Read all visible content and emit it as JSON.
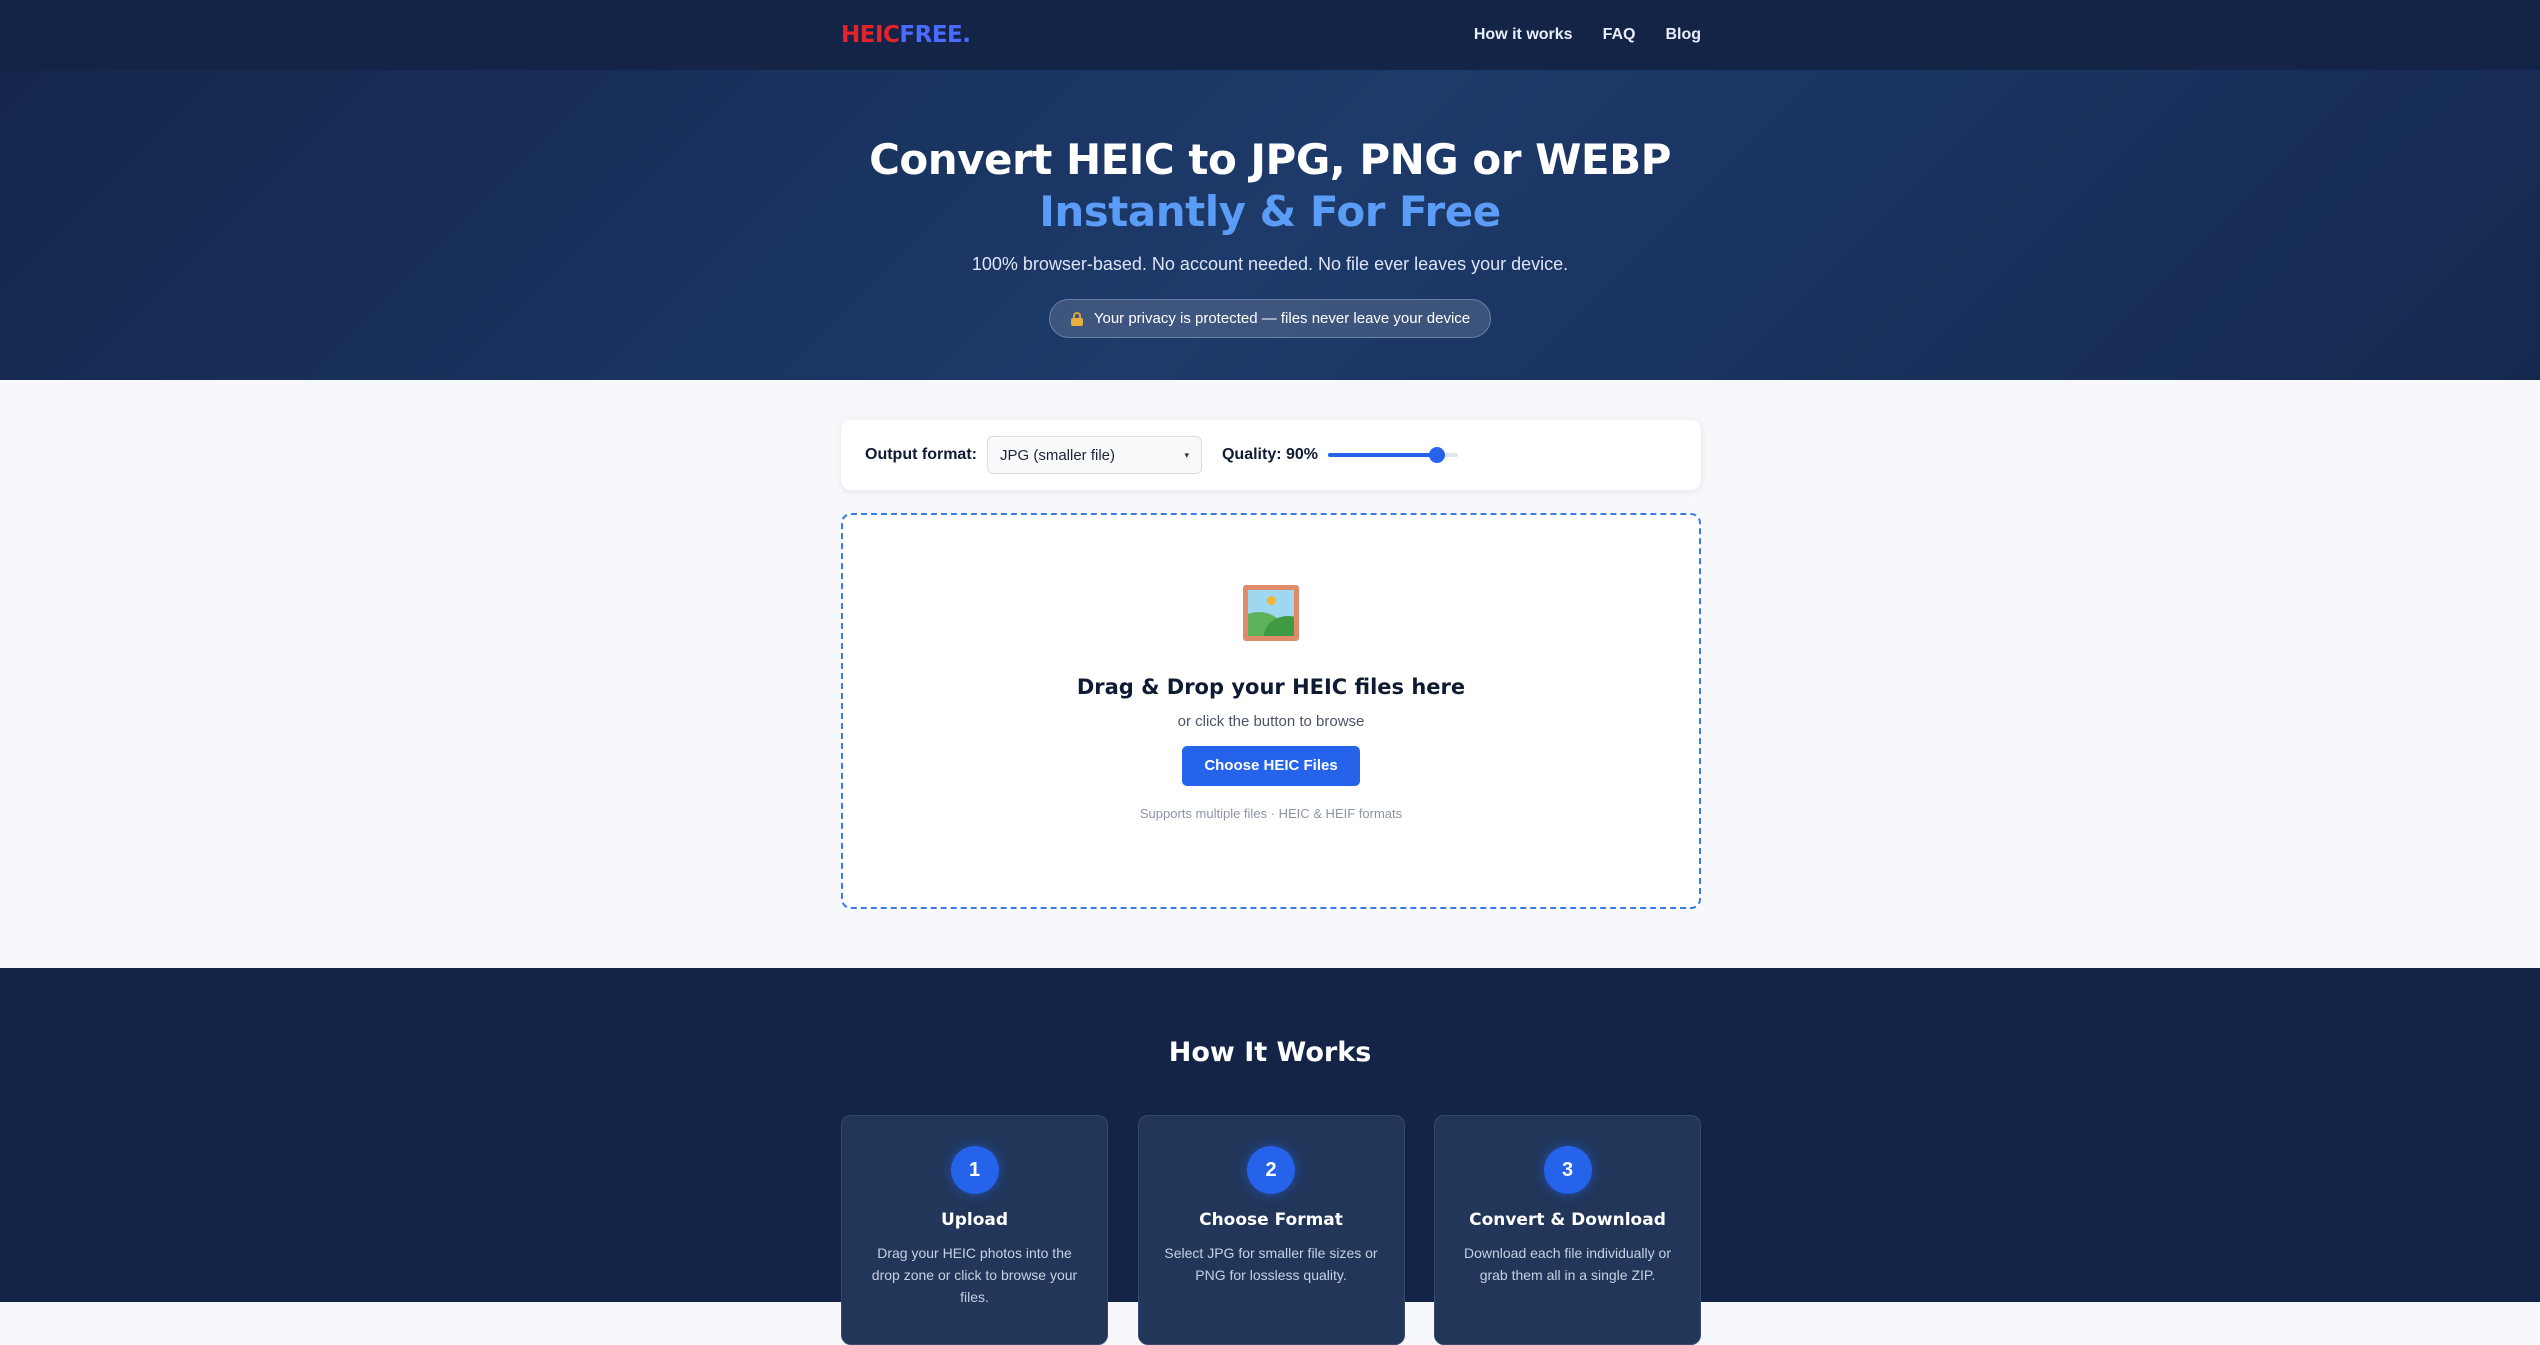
{
  "header": {
    "logo": {
      "part_a": "HEIC",
      "part_b": "FREE."
    },
    "nav": [
      {
        "label": "How it works"
      },
      {
        "label": "FAQ"
      },
      {
        "label": "Blog"
      }
    ]
  },
  "hero": {
    "title_line1": "Convert HEIC to JPG, PNG or WEBP",
    "title_line2": "Instantly & For Free",
    "subtitle": "100% browser-based. No account needed. No file ever leaves your device.",
    "privacy_badge": "Your privacy is protected — files never leave your device"
  },
  "settings": {
    "format_label": "Output format:",
    "format_selected": "JPG (smaller file)",
    "quality_label": "Quality: 90%",
    "quality_value": 0.9
  },
  "dropzone": {
    "title": "Drag & Drop your HEIC files here",
    "subtitle": "or click the button to browse",
    "button": "Choose HEIC Files",
    "hint": "Supports multiple files · HEIC & HEIF formats"
  },
  "how": {
    "title": "How It Works",
    "steps": [
      {
        "num": "1",
        "title": "Upload",
        "text": "Drag your HEIC photos into the drop zone or click to browse your files."
      },
      {
        "num": "2",
        "title": "Choose Format",
        "text": "Select JPG for smaller file sizes or PNG for lossless quality."
      },
      {
        "num": "3",
        "title": "Convert & Download",
        "text": "Download each file individually or grab them all in a single ZIP."
      }
    ]
  },
  "colors": {
    "navy": "#132447",
    "accent_blue": "#2563eb",
    "logo_red": "#e5232b",
    "logo_blue": "#4b6bff",
    "hero_accent": "#5b9cf6"
  }
}
